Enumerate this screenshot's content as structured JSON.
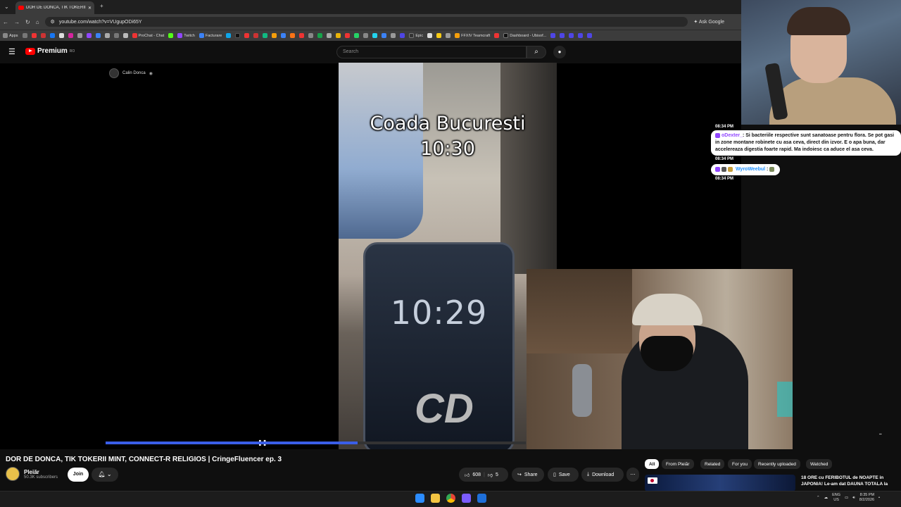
{
  "browser": {
    "tab_title": "DOR DE DONCA, TIK TOKERII M",
    "url": "youtube.com/watch?v=VUgupODi65Y",
    "ask_google": "Ask Google",
    "bookmarks": [
      "Apps",
      "ProChat - Chat",
      "Twitch",
      "Facturare",
      "Epic",
      "FFXIV Teamcraft",
      "Dashboard - Ubisof..."
    ]
  },
  "youtube": {
    "logo": "Premium",
    "logo_sup": "RO",
    "search_placeholder": "Search"
  },
  "video": {
    "channel_overlay": "Calin Donca",
    "overlay_line1": "Coada Bucuresti",
    "overlay_line2": "10:30",
    "phone_time": "10:29",
    "phone_logo": "CD",
    "progress_fraction": 0.6
  },
  "chat": {
    "ts1": "08:34 PM",
    "msg1_user": "oDexter_",
    "msg1_text": ": Si bacteriile respective sunt sanatoase pentru flora. Se pot gasi in zone montane robinete cu asa ceva, direct din izvor. E o apa buna, dar accelereaza digestia foarte rapid. Ma indoiesc ca aduce el asa ceva.",
    "ts2": "08:34 PM",
    "msg2_user": "WyroWeebul",
    "msg2_text": " :",
    "ts3": "08:34 PM"
  },
  "details": {
    "title": "DOR DE DONCA, TIK TOKERII MINT, CONNECT-R RELIGIOS | CringeFluencer ep. 3",
    "channel": "Pleiăr",
    "subscribers": "50.3K subscribers",
    "join": "Join",
    "likes": "608",
    "dislikes": "5",
    "share": "Share",
    "save": "Save",
    "download": "Download"
  },
  "chips": [
    "All",
    "From Pleiăr",
    "Related",
    "For you",
    "Recently uploaded",
    "Watched"
  ],
  "recommendation": {
    "title": "18 ORE cu FERIBOTUL de NOAPTE in JAPONIA! Le-am dat DAUNA TOTALA la"
  },
  "taskbar": {
    "lang": "ENG",
    "region": "US",
    "time": "8:35 PM",
    "date": "8/2/2026"
  }
}
